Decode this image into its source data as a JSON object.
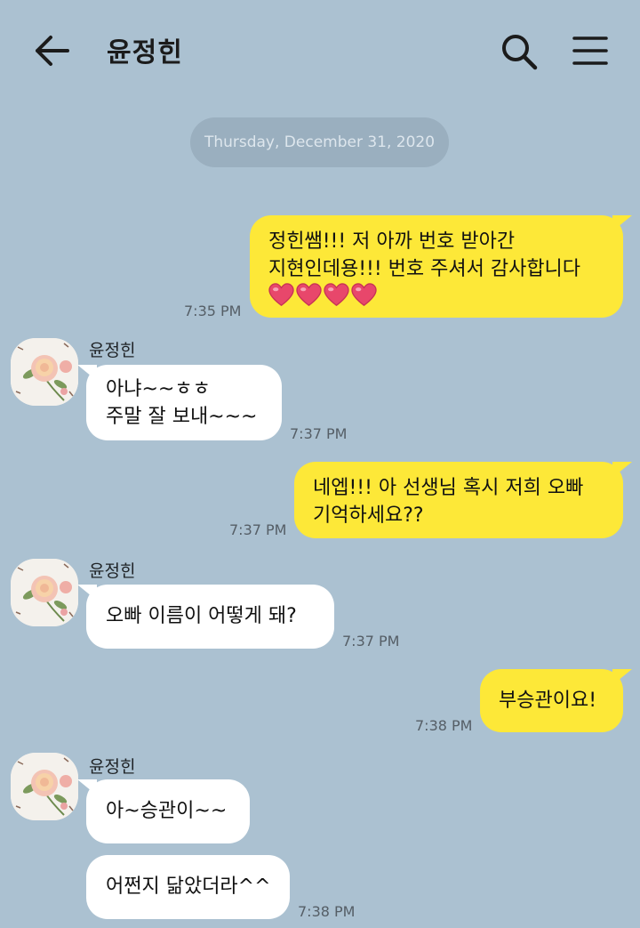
{
  "header": {
    "title": "윤정힌",
    "back_icon": "arrow-left-icon",
    "search_icon": "search-icon",
    "menu_icon": "hamburger-menu-icon"
  },
  "date_divider": "Thursday, December 31, 2020",
  "colors": {
    "background": "#abc1d1",
    "sent_bubble": "#fde838",
    "received_bubble": "#ffffff",
    "heart": "#e8476b"
  },
  "messages": [
    {
      "direction": "sent",
      "lines": [
        "정힌쌤!!! 저 아까 번호 받아간",
        "지현인데용!!! 번호 주셔서 감사합니다"
      ],
      "hearts": 4,
      "time": "7:35 PM"
    },
    {
      "direction": "received",
      "sender": "윤정힌",
      "lines": [
        "아냐~~ㅎㅎ",
        "주말 잘 보내~~~"
      ],
      "time": "7:37 PM"
    },
    {
      "direction": "sent",
      "lines": [
        "네엡!!! 아 선생님 혹시 저희 오빠",
        "기억하세요??"
      ],
      "time": "7:37 PM"
    },
    {
      "direction": "received",
      "sender": "윤정힌",
      "lines": [
        "오빠 이름이 어떻게 돼?"
      ],
      "time": "7:37 PM"
    },
    {
      "direction": "sent",
      "lines": [
        "부승관이요!"
      ],
      "time": "7:38 PM"
    },
    {
      "direction": "received",
      "sender": "윤정힌",
      "lines": [
        "아~승관이~~"
      ]
    },
    {
      "direction": "received",
      "lines": [
        "어쩐지 닮았더라^^"
      ],
      "time": "7:38 PM"
    }
  ]
}
